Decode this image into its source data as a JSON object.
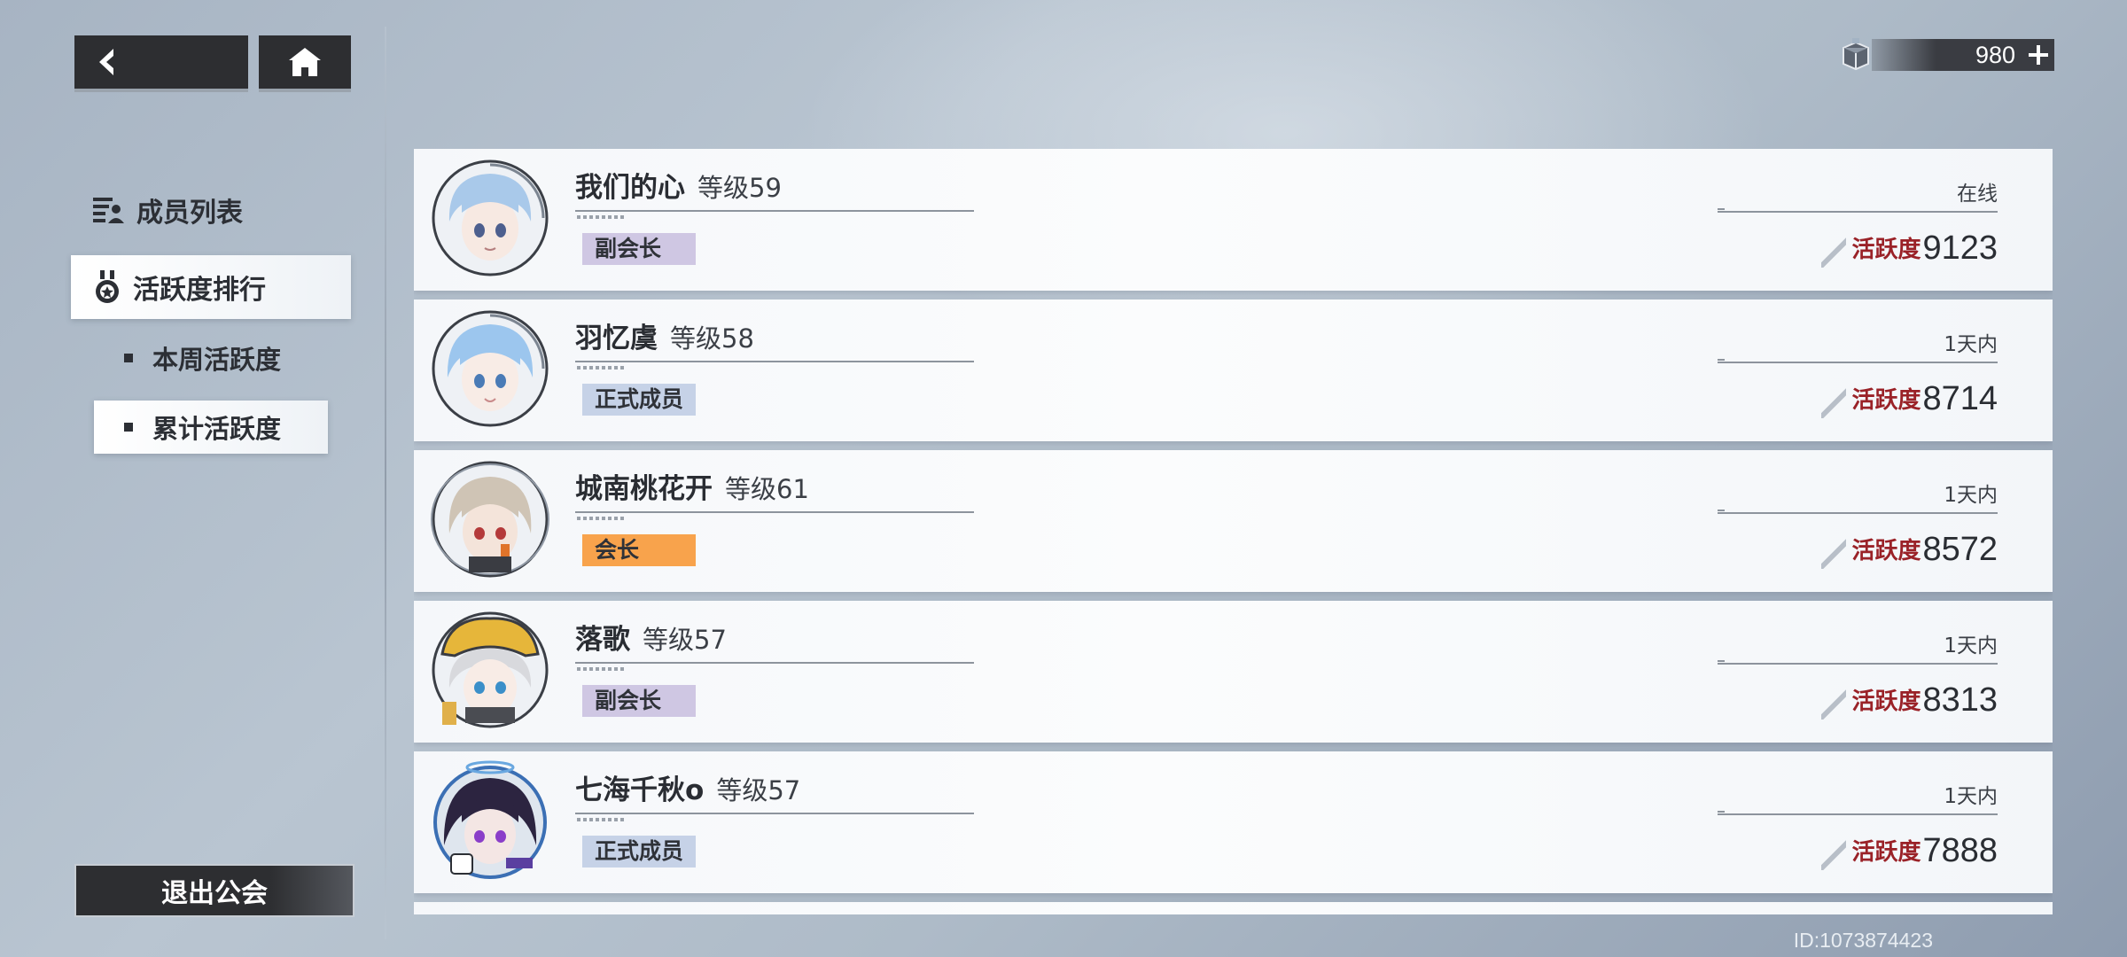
{
  "currency": {
    "icon": "crate-icon",
    "value": "980"
  },
  "sidebar": {
    "title": "成员列表",
    "tab": "活跃度排行",
    "sub_items": [
      {
        "label": "本周活跃度",
        "selected": false
      },
      {
        "label": "累计活跃度",
        "selected": true
      }
    ],
    "quit_label": "退出公会"
  },
  "members": [
    {
      "name": "我们的心",
      "level": "等级59",
      "role": "副会长",
      "status": "在线",
      "activity_label": "活跃度",
      "activity": "9123",
      "hair": "#a9c9ea"
    },
    {
      "name": "羽忆虞",
      "level": "等级58",
      "role": "正式成员",
      "status": "1天内",
      "activity_label": "活跃度",
      "activity": "8714",
      "hair": "#9cc6ee"
    },
    {
      "name": "城南桃花开",
      "level": "等级61",
      "role": "会长",
      "status": "1天内",
      "activity_label": "活跃度",
      "activity": "8572",
      "hair": "#cfc4b5"
    },
    {
      "name": "落歌",
      "level": "等级57",
      "role": "副会长",
      "status": "1天内",
      "activity_label": "活跃度",
      "activity": "8313",
      "hair": "#d8d9dd"
    },
    {
      "name": "七海千秋o",
      "level": "等级57",
      "role": "正式成员",
      "status": "1天内",
      "activity_label": "活跃度",
      "activity": "7888",
      "hair": "#2c2440"
    }
  ],
  "footer": {
    "player_id": "ID:1073874423"
  }
}
